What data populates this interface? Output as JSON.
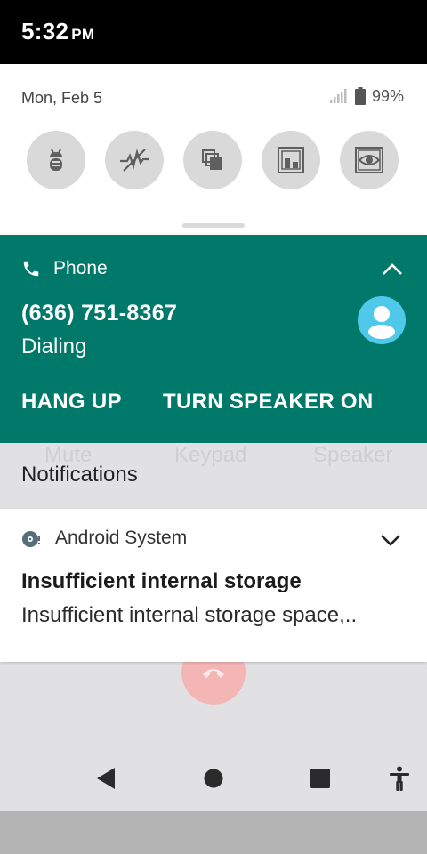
{
  "status_bar": {
    "time": "5:32",
    "ampm": "PM"
  },
  "quick_settings": {
    "date": "Mon, Feb 5",
    "battery_percent": "99%",
    "tiles": [
      {
        "name": "android-debug-tile",
        "icon": "bug-icon"
      },
      {
        "name": "cellular-signal-tile",
        "icon": "no-signal-icon"
      },
      {
        "name": "copy-tile",
        "icon": "copy-icon"
      },
      {
        "name": "layout-bounds-tile",
        "icon": "layout-bounds-icon"
      },
      {
        "name": "screen-eye-tile",
        "icon": "eye-icon"
      }
    ]
  },
  "call_notification": {
    "app_name": "Phone",
    "number": "(636) 751-8367",
    "state": "Dialing",
    "actions": {
      "hang_up": "HANG UP",
      "speaker": "TURN SPEAKER ON"
    },
    "color": "#00796b"
  },
  "background_call_screen": {
    "labels": {
      "mute": "Mute",
      "keypad": "Keypad",
      "speaker": "Speaker"
    }
  },
  "notifications": {
    "header": "Notifications",
    "items": [
      {
        "app_name": "Android System",
        "title": "Insufficient internal storage",
        "text": "Insufficient internal storage space,.."
      }
    ]
  }
}
